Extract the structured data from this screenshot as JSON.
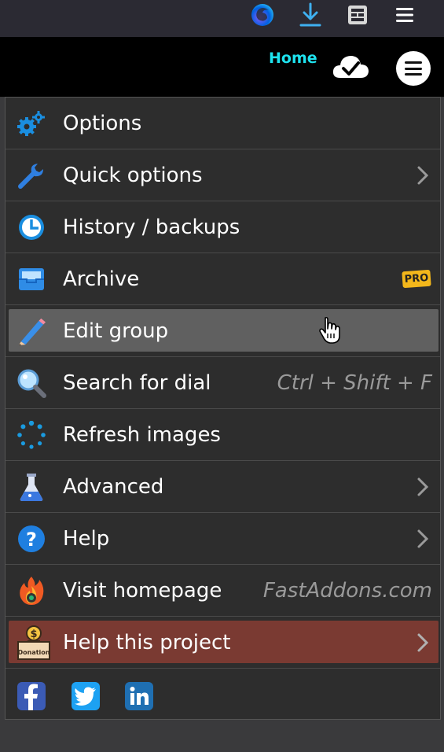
{
  "header": {
    "home_label": "Home"
  },
  "menu": {
    "items": [
      {
        "label": "Options",
        "icon": "gears-icon"
      },
      {
        "label": "Quick options",
        "icon": "wrench-icon",
        "submenu": true
      },
      {
        "label": "History / backups",
        "icon": "clock-icon"
      },
      {
        "label": "Archive",
        "icon": "archive-tray-icon",
        "badge": "PRO"
      },
      {
        "label": "Edit group",
        "icon": "pencil-icon",
        "hovered": true
      },
      {
        "label": "Search for dial",
        "icon": "magnifier-icon",
        "shortcut": "Ctrl + Shift + F"
      },
      {
        "label": "Refresh images",
        "icon": "spinner-icon"
      },
      {
        "label": "Advanced",
        "icon": "flask-icon",
        "submenu": true
      },
      {
        "label": "Help",
        "icon": "question-icon",
        "submenu": true
      },
      {
        "label": "Visit homepage",
        "icon": "fire-icon",
        "link": "FastAddons.com"
      },
      {
        "label": "Help this project",
        "icon": "donation-box-icon",
        "submenu": true
      }
    ],
    "donation_box_text": "Donation",
    "social": [
      "facebook-icon",
      "twitter-icon",
      "linkedin-icon"
    ]
  },
  "colors": {
    "accent_home": "#1ee3ef",
    "hover_bg": "#606060",
    "donate_bg": "#7a3a32",
    "menu_bg": "#2d2d2d"
  }
}
